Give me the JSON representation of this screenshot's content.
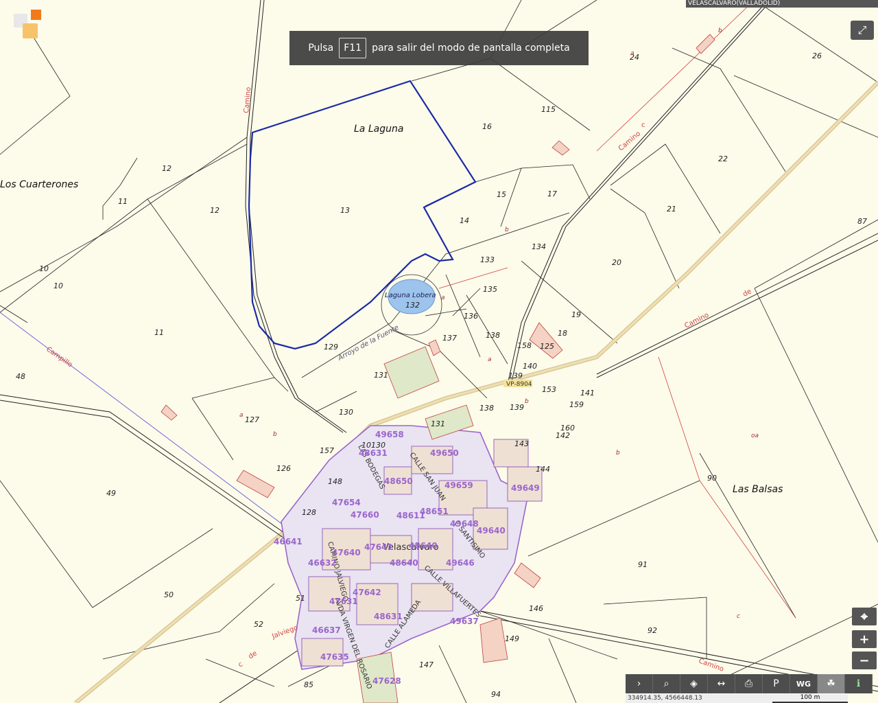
{
  "banner": {
    "pre": "Pulsa",
    "key": "F11",
    "post": "para salir del modo de pantalla completa"
  },
  "municipality": "VELASCALVARO(VALLADOLID)",
  "places": {
    "la_laguna": "La Laguna",
    "los_cuarterones": "Los Cuarterones",
    "las_balsas": "Las Balsas",
    "laguna_lobera": "Laguna Lobera",
    "town": "Velascalvaro",
    "arroyo": "Arroyo de la Fuente"
  },
  "roads": {
    "vp": "VP-8904",
    "camino": "Camino",
    "campillo": "Campillo",
    "de": "de",
    "c": "c",
    "jalviego": "Jalviego"
  },
  "streets": {
    "bodegas": "LAS BODEGAS",
    "san_juan": "CALLE SAN JUAN",
    "santisimo": "C SANTISIMO",
    "villafuertes": "CALLE VILLAFUERTES",
    "alameda": "CALLE ALAMEDA",
    "virgen": "AVDA VIRGEN DEL ROSARIO",
    "jalviego": "CAMINO JALVIEGO"
  },
  "parcels": {
    "p13": "13",
    "p14": "14",
    "p15": "15",
    "p16": "16",
    "p17": "17",
    "p115": "115",
    "p24": "24",
    "p26": "26",
    "p22": "22",
    "p21": "21",
    "p87": "87",
    "p20": "20",
    "p134": "134",
    "p133": "133",
    "p135": "135",
    "p136": "136",
    "p137": "137",
    "p138a": "138",
    "p19": "19",
    "p18": "18",
    "p125": "125",
    "p158": "158",
    "p140": "140",
    "p139a": "139",
    "p153": "153",
    "p141": "141",
    "p159": "159",
    "p160": "160",
    "p142": "142",
    "p143": "143",
    "p144": "144",
    "p12a": "12",
    "p12b": "12",
    "p11a": "11",
    "p11b": "11",
    "p10a": "10",
    "p10b": "10",
    "p48": "48",
    "p129": "129",
    "p132": "132",
    "p131a": "131",
    "p130": "130",
    "p127": "127",
    "p157": "157",
    "p126": "126",
    "p148": "148",
    "p128": "128",
    "p49": "49",
    "p50": "50",
    "p51": "51",
    "p52": "52",
    "p85": "85",
    "p147": "147",
    "p94": "94",
    "p149": "149",
    "p146": "146",
    "p92": "92",
    "p91": "91",
    "p90": "90",
    "p138b": "138",
    "p139b": "139",
    "p131b": "131",
    "p10130": "10130"
  },
  "letters": {
    "a": "a",
    "b": "b",
    "c": "c",
    "oa": "oa"
  },
  "urban_blocks": {
    "u1": "49658",
    "u2": "48631",
    "u3": "49650",
    "u4": "48650",
    "u5": "49659",
    "u6": "47654",
    "u7": "47660",
    "u8": "48611",
    "u9": "48651",
    "u10": "49648",
    "u11": "49649",
    "u12": "49640",
    "u13": "46641",
    "u14": "47640",
    "u15": "47641",
    "u16": "48640",
    "u17": "49646",
    "u18": "46632",
    "u19": "47642",
    "u20": "47631",
    "u21": "48631",
    "u22": "49637",
    "u23": "46637",
    "u24": "47635",
    "u25": "47628",
    "u26": "48640"
  },
  "toolbar": {
    "items": [
      {
        "name": "expand",
        "icon": "›"
      },
      {
        "name": "search",
        "icon": "⌕"
      },
      {
        "name": "layers",
        "icon": "◈"
      },
      {
        "name": "measure",
        "icon": "↔"
      },
      {
        "name": "print",
        "icon": "⎙"
      },
      {
        "name": "parking",
        "icon": "P"
      },
      {
        "name": "wg",
        "icon": "WG"
      },
      {
        "name": "cluster",
        "icon": "☘"
      },
      {
        "name": "info",
        "icon": "ℹ"
      }
    ]
  },
  "coords": "334914.35, 4566448.13",
  "scale": "100 m",
  "side": {
    "locate": "⌖",
    "zoom_in": "+",
    "zoom_out": "−"
  }
}
